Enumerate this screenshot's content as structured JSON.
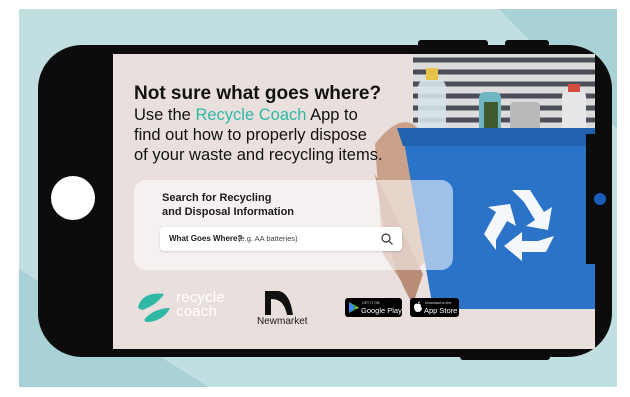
{
  "headline": {
    "title": "Not sure what goes where?",
    "line2_prefix": "Use the ",
    "line2_brand": "Recycle Coach",
    "line2_suffix": " App to",
    "line3": "find out how to properly dispose",
    "line4": "of your waste and recycling items."
  },
  "search": {
    "title_line1": "Search for Recycling",
    "title_line2": "and Disposal Information",
    "label": "What Goes Where?",
    "placeholder": "(e.g. AA batteries)"
  },
  "logos": {
    "recycle_coach_line1": "recycle",
    "recycle_coach_line2": "coach",
    "newmarket": "Newmarket"
  },
  "stores": {
    "google_small": "GET IT ON",
    "google_big": "Google Play",
    "apple_small": "Download on the",
    "apple_big": "App Store"
  },
  "colors": {
    "brand_teal": "#2fb8a4",
    "bin_blue": "#2a73c9",
    "background": "#c1dfe1"
  }
}
